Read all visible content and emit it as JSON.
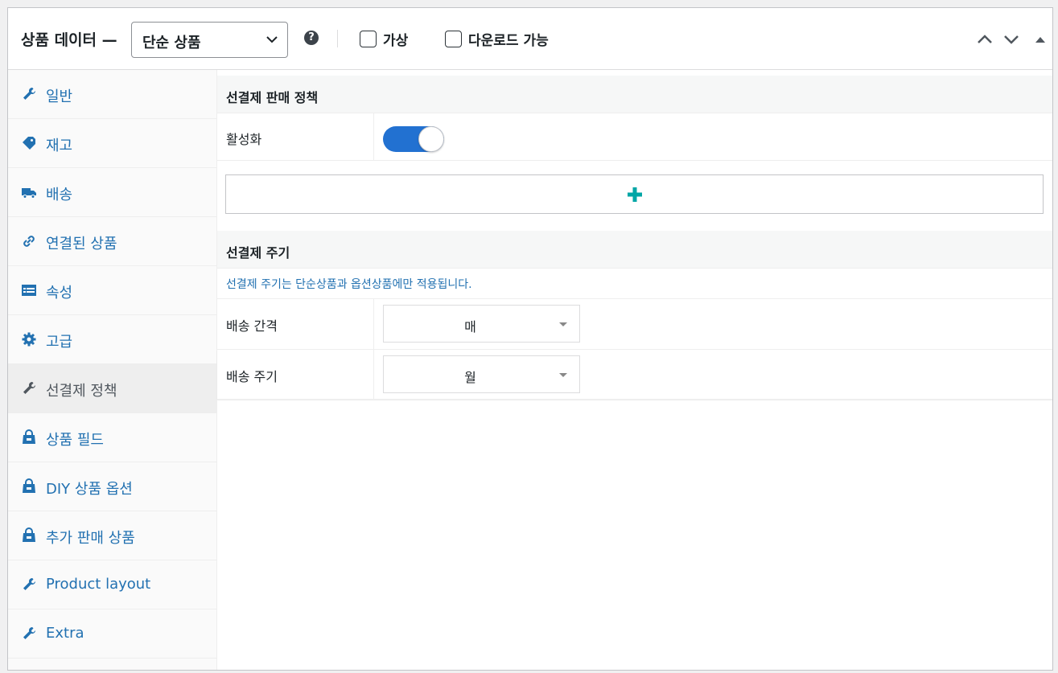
{
  "header": {
    "title": "상품 데이터 —",
    "product_type": "단순 상품",
    "help": "?",
    "virtual_label": "가상",
    "downloadable_label": "다운로드 가능"
  },
  "sidebar": {
    "items": [
      {
        "label": "일반",
        "icon": "wrench-icon"
      },
      {
        "label": "재고",
        "icon": "tag-icon"
      },
      {
        "label": "배송",
        "icon": "truck-icon"
      },
      {
        "label": "연결된 상품",
        "icon": "link-icon"
      },
      {
        "label": "속성",
        "icon": "list-icon"
      },
      {
        "label": "고급",
        "icon": "gear-icon"
      },
      {
        "label": "선결제 정책",
        "icon": "wrench-icon",
        "active": true
      },
      {
        "label": "상품 필드",
        "icon": "bag-icon"
      },
      {
        "label": "DIY 상품 옵션",
        "icon": "bag-icon"
      },
      {
        "label": "추가 판매 상품",
        "icon": "bag-icon"
      },
      {
        "label": "Product layout",
        "icon": "wrench-icon"
      },
      {
        "label": "Extra",
        "icon": "wrench-icon"
      }
    ]
  },
  "main": {
    "policy_heading": "선결제 판매 정책",
    "activate_label": "활성화",
    "activate_on": true,
    "cycle_heading": "선결제 주기",
    "cycle_note": "선결제 주기는 단순상품과 옵션상품에만 적용됩니다.",
    "interval_label": "배송 간격",
    "interval_value": "매",
    "period_label": "배송 주기",
    "period_value": "월"
  },
  "colors": {
    "link": "#2271b1",
    "toggle_on": "#2271d1",
    "plus": "#00a6a6"
  }
}
